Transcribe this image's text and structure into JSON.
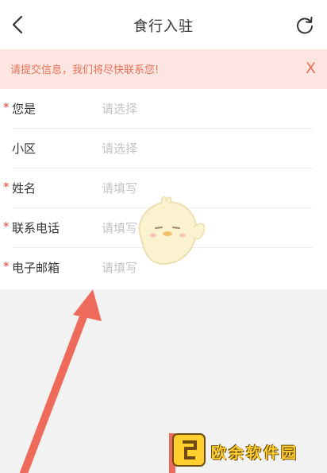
{
  "header": {
    "title": "食行入驻",
    "back_icon": "chevron-left-icon",
    "refresh_icon": "refresh-icon"
  },
  "notice": {
    "text": "请提交信息，我们将尽快联系您!",
    "close_label": "X",
    "background": "#fde6e1",
    "text_color": "#e57259"
  },
  "form": {
    "rows": [
      {
        "required": true,
        "label": "您是",
        "placeholder": "请选择",
        "kind": "select"
      },
      {
        "required": false,
        "label": "小区",
        "placeholder": "请选择",
        "kind": "select"
      },
      {
        "required": true,
        "label": "姓名",
        "placeholder": "请填写",
        "kind": "text"
      },
      {
        "required": true,
        "label": "联系电话",
        "placeholder": "请填写",
        "kind": "text"
      },
      {
        "required": true,
        "label": "电子邮箱",
        "placeholder": "请填写",
        "kind": "text"
      }
    ],
    "required_mark": "*"
  },
  "overlay": {
    "watermark_text": "欧余软件园",
    "arrow_color": "#ee6b5c",
    "mascot": "chick-mascot"
  }
}
